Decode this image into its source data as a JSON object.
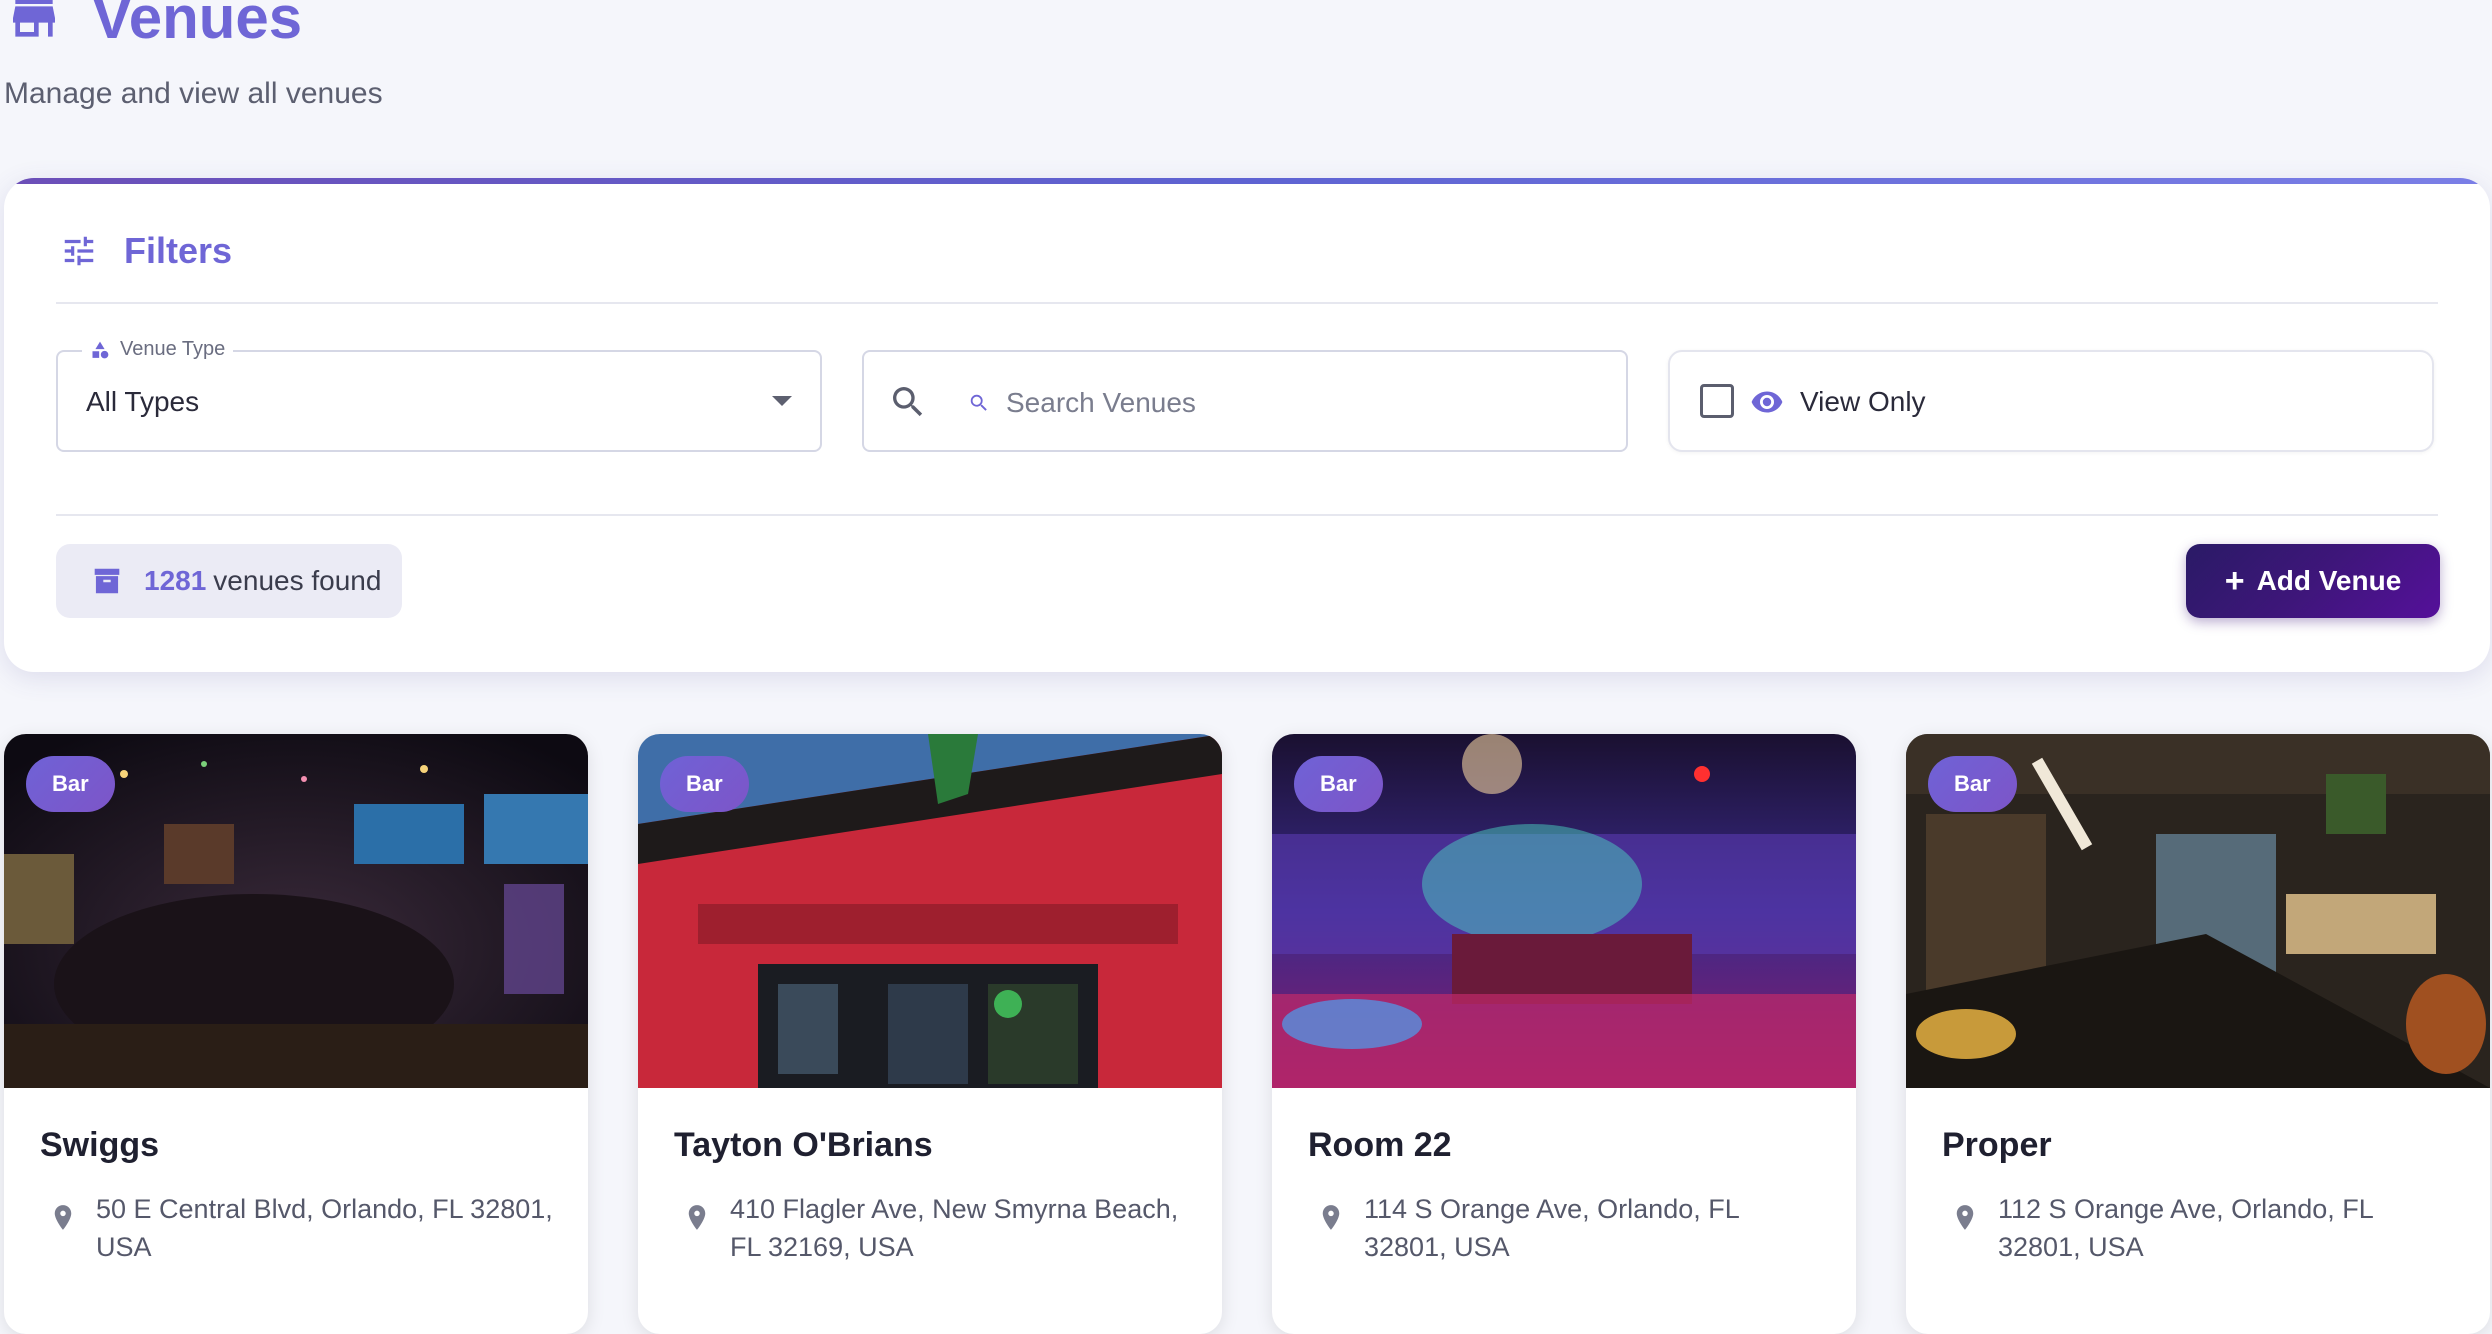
{
  "header": {
    "title": "Venues",
    "subtitle": "Manage and view all venues",
    "icon": "store-icon"
  },
  "filters": {
    "title": "Filters",
    "venue_type_label": "Venue Type",
    "venue_type_value": "All Types",
    "search_placeholder": "Search Venues",
    "view_only_label": "View Only",
    "view_only_checked": false
  },
  "results": {
    "count": "1281",
    "count_suffix": "venues found"
  },
  "actions": {
    "add_venue_label": "Add Venue"
  },
  "colors": {
    "accent": "#6f66d6",
    "button_dark": "#3e167a",
    "badge": "#6f62d6"
  },
  "venues": [
    {
      "type": "Bar",
      "name": "Swiggs",
      "address": "50 E Central Blvd, Orlando, FL 32801, USA"
    },
    {
      "type": "Bar",
      "name": "Tayton O'Brians",
      "address": "410 Flagler Ave, New Smyrna Beach, FL 32169, USA"
    },
    {
      "type": "Bar",
      "name": "Room 22",
      "address": "114 S Orange Ave, Orlando, FL 32801, USA"
    },
    {
      "type": "Bar",
      "name": "Proper",
      "address": "112 S Orange Ave, Orlando, FL 32801, USA"
    }
  ]
}
